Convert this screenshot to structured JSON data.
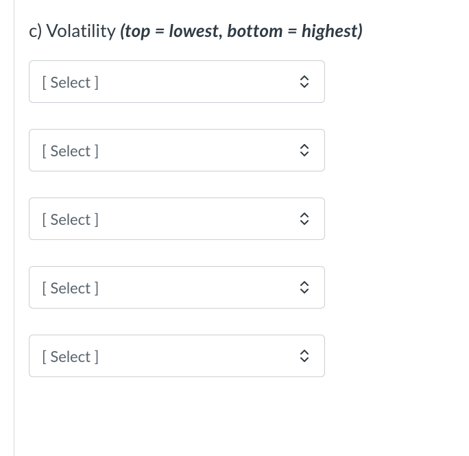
{
  "prompt": {
    "prefix": "c) ",
    "label": "Volatility",
    "hint": "(top = lowest, bottom = highest)"
  },
  "selects": [
    {
      "placeholder": "[ Select ]"
    },
    {
      "placeholder": "[ Select ]"
    },
    {
      "placeholder": "[ Select ]"
    },
    {
      "placeholder": "[ Select ]"
    },
    {
      "placeholder": "[ Select ]"
    }
  ]
}
